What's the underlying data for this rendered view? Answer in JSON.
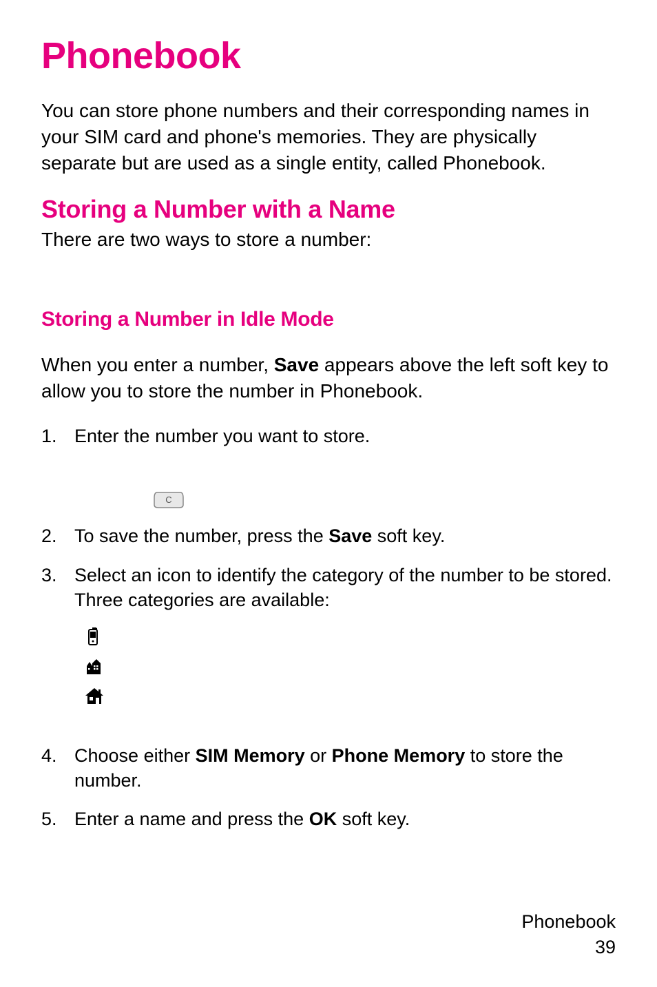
{
  "title": "Phonebook",
  "intro": "You can store phone numbers and their corresponding names in your SIM card and phone's memories. They are physically separate but are used as a single entity, called Phonebook.",
  "section1_heading": "Storing a Number with a Name",
  "section1_text": "There are two ways to store a number:",
  "section2_heading": "Storing a Number in Idle Mode",
  "section2_intro_pre": "When you enter a number, ",
  "section2_intro_bold": "Save",
  "section2_intro_post": " appears above the left soft key to allow you to store the number in Phonebook.",
  "steps": {
    "1": {
      "num": "1.",
      "text": "Enter the number you want to store."
    },
    "2": {
      "num": "2.",
      "pre": "To save the number, press the ",
      "bold": "Save",
      "post": " soft key."
    },
    "3": {
      "num": "3.",
      "text": "Select an icon to identify the category of the number to be stored. Three categories are available:"
    },
    "4": {
      "num": "4.",
      "pre": "Choose either ",
      "bold1": "SIM Memory",
      "mid": " or ",
      "bold2": "Phone Memory",
      "post": " to store the number."
    },
    "5": {
      "num": "5.",
      "pre": "Enter a name and press the ",
      "bold": "OK",
      "post": " soft key."
    }
  },
  "icons": {
    "c_key": "c-key-icon",
    "mobile": "mobile-icon",
    "office": "office-icon",
    "home": "home-icon"
  },
  "footer_label": "Phonebook",
  "footer_page": "39"
}
